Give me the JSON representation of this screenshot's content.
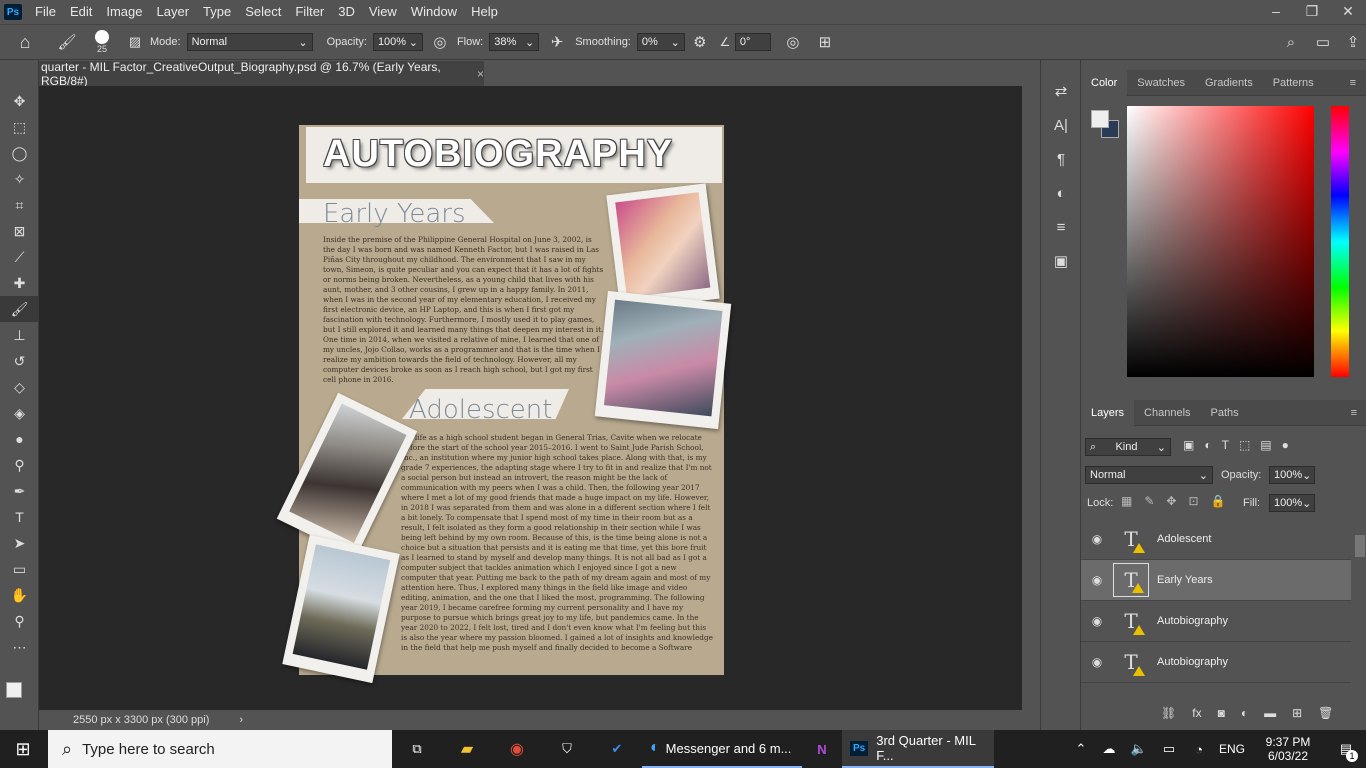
{
  "app": {
    "logo": "Ps"
  },
  "menu": [
    "File",
    "Edit",
    "Image",
    "Layer",
    "Type",
    "Select",
    "Filter",
    "3D",
    "View",
    "Window",
    "Help"
  ],
  "window_controls": [
    "–",
    "❐",
    "✕"
  ],
  "options": {
    "brush_size": "25",
    "mode_label": "Mode:",
    "mode_value": "Normal",
    "opacity_label": "Opacity:",
    "opacity_value": "100%",
    "flow_label": "Flow:",
    "flow_value": "38%",
    "smoothing_label": "Smoothing:",
    "smoothing_value": "0%",
    "angle_value": "0°"
  },
  "document": {
    "tab_title": "quarter - MIL Factor_CreativeOutput_Biography.psd @ 16.7% (Early Years, RGB/8#)",
    "tab_close": "×",
    "status": "2550 px x 3300 px (300 ppi)",
    "title": "AUTOBIOGRAPHY",
    "heading1": "Early Years",
    "body1": "Inside the premise of the Philippine General Hospital on June 3, 2002, is the day I was born and was named Kenneth Factor, but I was raised in Las Piñas City throughout my childhood. The environment that I saw in my town, Simeon, is quite peculiar and you can expect that it has a lot of fights or norms being broken. Nevertheless, as a young child that lives with his aunt, mother, and 3 other cousins, I grew up in a happy family. In 2011, when I was in the second year of my elementary education, I received my first electronic device, an HP Laptop, and this is when I first got my fascination with technology. Furthermore, I mostly used it to play games, but I still explored it and learned many things that deepen my interest in it. One time in 2014, when we visited a relative of mine, I learned that one of my uncles, Jojo Collao, works as a programmer and that is the time when I realize my ambition towards the field of technology. However, all my computer devices broke as soon as I reach high school, but I got my first cell phone in 2016.",
    "heading2": "Adolescent",
    "body2": "My life as a high school student began in General Trias, Cavite when we relocate before the start of the school year 2015–2016. I went to Saint Jude Parish School, Inc., an institution where my junior high school takes place. Along with that, is my grade 7 experiences, the adapting stage where I try to fit in and realize that I'm not a social person but instead an introvert, the reason might be the lack of communication with my peers when I was a child. Then, the following year 2017 where I met a lot of my good friends that made a huge impact on my life. However, in 2018 I was separated from them and was alone in a different section where I felt a bit lonely. To compensate that I spend most of my time in their room but as a result, I felt isolated as they form a good relationship in their section while I was being left behind by my own room. Because of this, is the time being alone is not a choice but a situation that persists and it is eating me that time, yet this bore fruit as I learned to stand by myself and develop many things. It is not all bad as I got a computer subject that tackles animation which I enjoyed since I got a new computer that year. Putting me back to the path of my dream again and most of my attention here. Thus, I explored many things in the field like image and video editing, animation, and the one that I liked the most, programming. The following year 2019, I became carefree forming my current personality and I have my purpose to pursue which brings great joy to my life, but pandemics came. In the year 2020 to 2022, I felt lost, tired and I don't even know what I'm feeling but this is also the year where my passion bloomed. I gained a lot of insights and knowledge in the field that help me push myself and finally decided to become a Software Engineer."
  },
  "color_panel": {
    "tabs": [
      "Color",
      "Swatches",
      "Gradients",
      "Patterns"
    ],
    "active": "Color"
  },
  "layers_panel": {
    "tabs": [
      "Layers",
      "Channels",
      "Paths"
    ],
    "kind_label": "Kind",
    "blend_mode": "Normal",
    "opacity_label": "Opacity:",
    "opacity_value": "100%",
    "lock_label": "Lock:",
    "fill_label": "Fill:",
    "fill_value": "100%",
    "layers": [
      {
        "name": "Adolescent"
      },
      {
        "name": "Early Years",
        "selected": true
      },
      {
        "name": "Autobiography"
      },
      {
        "name": "Autobiography"
      }
    ]
  },
  "taskbar": {
    "search_placeholder": "Type here to search",
    "messenger": "Messenger and 6 m...",
    "photoshop": "3rd Quarter - MIL F...",
    "lang": "ENG",
    "time": "9:37 PM",
    "date": "6/03/22",
    "notif_count": "1"
  },
  "colors": {
    "accent": "#31a8ff",
    "panel": "#535353",
    "canvas_bg": "#282828"
  }
}
